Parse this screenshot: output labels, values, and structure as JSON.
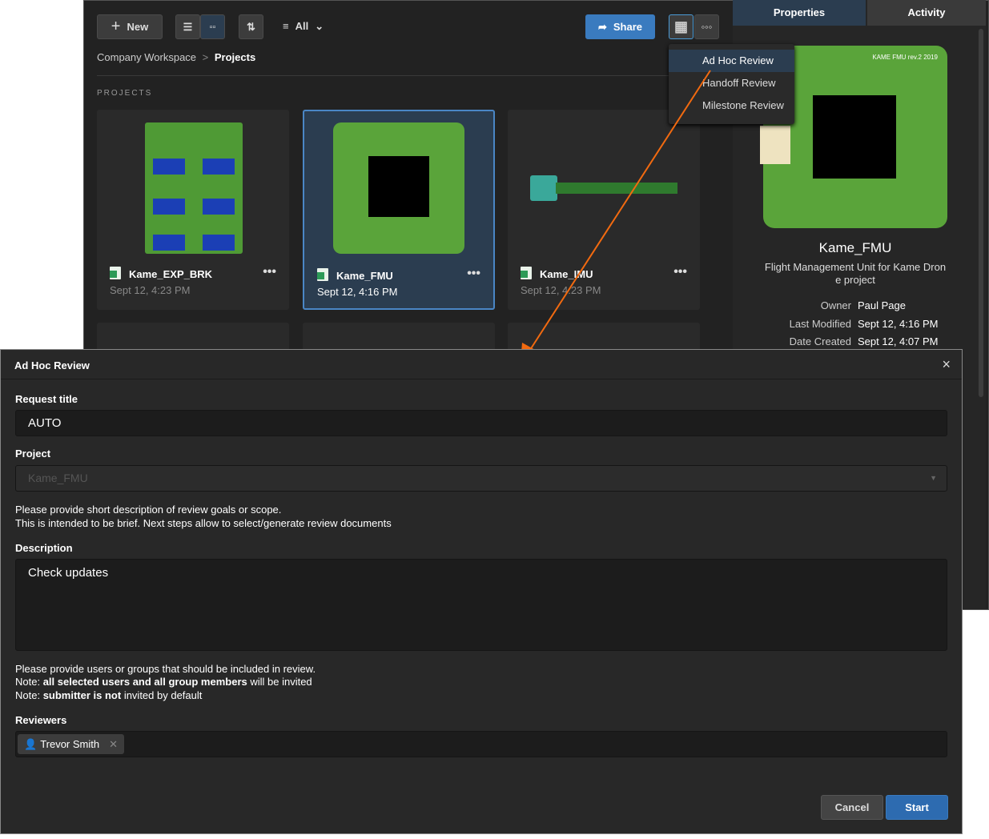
{
  "toolbar": {
    "new_label": "New",
    "filter_label": "All",
    "share_label": "Share"
  },
  "breadcrumb": {
    "root": "Company Workspace",
    "sep": ">",
    "current": "Projects"
  },
  "section_label": "PROJECTS",
  "projects": [
    {
      "name": "Kame_EXP_BRK",
      "date": "Sept 12, 4:23 PM"
    },
    {
      "name": "Kame_FMU",
      "date": "Sept 12, 4:16 PM"
    },
    {
      "name": "Kame_IMU",
      "date": "Sept 12, 4:23 PM"
    }
  ],
  "menu": {
    "items": [
      "Ad Hoc Review",
      "Handoff Review",
      "Milestone Review"
    ]
  },
  "panel": {
    "tabs": [
      "Properties",
      "Activity"
    ],
    "pcb_label": "KAME FMU rev.2 2019",
    "title": "Kame_FMU",
    "description": "Flight Management Unit for Kame Drone project",
    "props": [
      {
        "k": "Owner",
        "v": "Paul Page"
      },
      {
        "k": "Last Modified",
        "v": "Sept 12, 4:16 PM"
      },
      {
        "k": "Date Created",
        "v": "Sept 12, 4:07 PM"
      }
    ]
  },
  "dialog": {
    "title": "Ad Hoc Review",
    "close": "×",
    "request_title_label": "Request title",
    "request_title_value": "AUTO",
    "project_label": "Project",
    "project_value": "Kame_FMU",
    "help1": "Please provide short description of review goals or scope.",
    "help2": "This is intended to be brief. Next steps allow to select/generate review documents",
    "description_label": "Description",
    "description_value": "Check updates",
    "rev_help1": "Please provide users or groups that should be included in review.",
    "rev_help2_a": "Note: ",
    "rev_help2_b": "all selected users and all group members",
    "rev_help2_c": " will be invited",
    "rev_help3_a": "Note: ",
    "rev_help3_b": "submitter is not",
    "rev_help3_c": " invited by default",
    "reviewers_label": "Reviewers",
    "reviewers": [
      "Trevor Smith"
    ],
    "cancel": "Cancel",
    "start": "Start"
  },
  "colors": {
    "accent": "#3a7bbf",
    "arrow": "#f26a10",
    "selected": "#2b3d50"
  }
}
